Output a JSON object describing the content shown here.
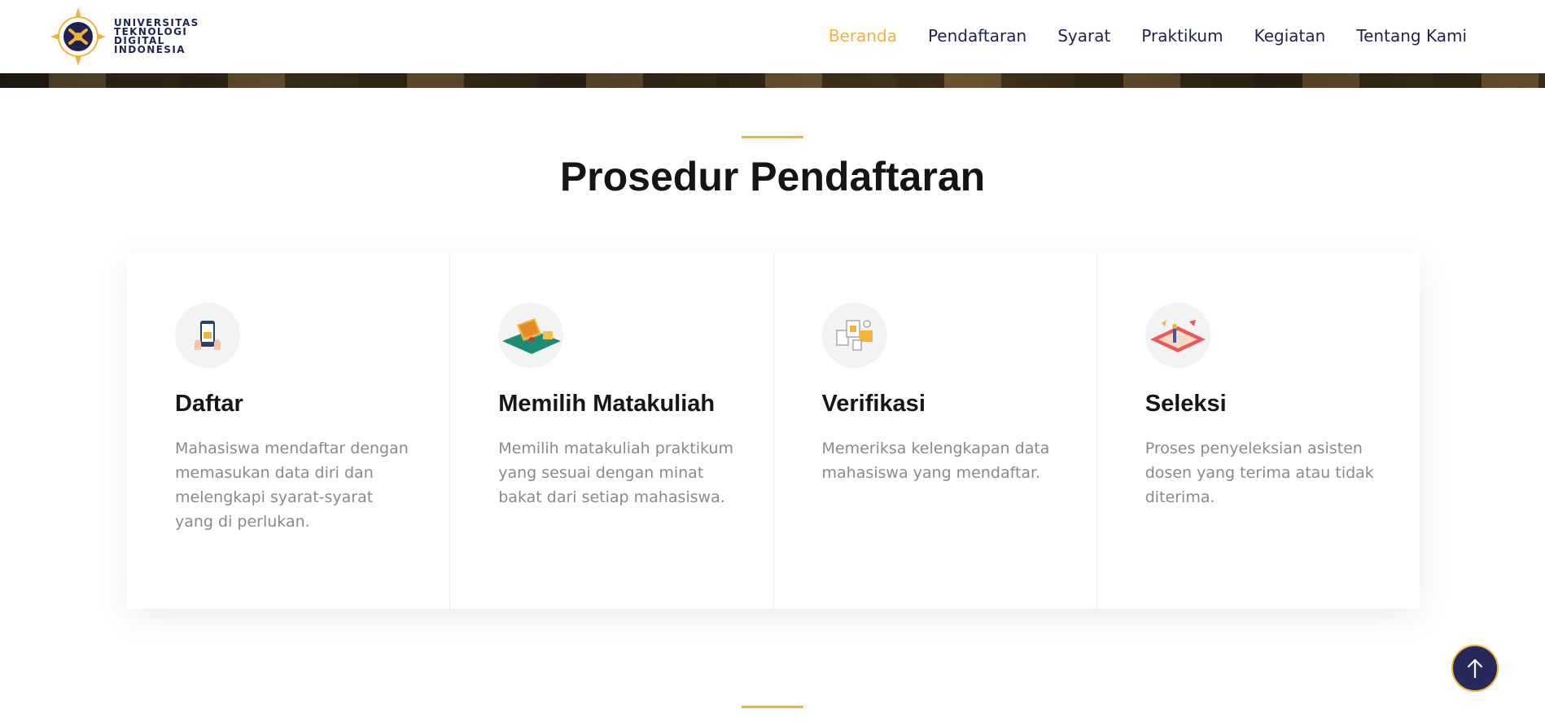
{
  "brand": {
    "lines": [
      "UNIVERSITAS",
      "TEKNOLOGI",
      "DIGITAL",
      "INDONESIA"
    ]
  },
  "nav": {
    "items": [
      {
        "label": "Beranda",
        "active": true
      },
      {
        "label": "Pendaftaran",
        "active": false
      },
      {
        "label": "Syarat",
        "active": false
      },
      {
        "label": "Praktikum",
        "active": false
      },
      {
        "label": "Kegiatan",
        "active": false
      },
      {
        "label": "Tentang Kami",
        "active": false
      }
    ]
  },
  "section": {
    "title": "Prosedur Pendaftaran"
  },
  "cards": [
    {
      "icon": "phone-register-icon",
      "title": "Daftar",
      "desc": "Mahasiswa mendaftar dengan memasukan data diri dan melengkapi syarat-syarat yang di perlukan."
    },
    {
      "icon": "laptop-select-icon",
      "title": "Memilih Matakuliah",
      "desc": "Memilih matakuliah praktikum yang sesuai dengan minat bakat dari setiap mahasiswa."
    },
    {
      "icon": "document-verify-icon",
      "title": "Verifikasi",
      "desc": "Memeriksa kelengkapan data mahasiswa yang mendaftar."
    },
    {
      "icon": "selection-board-icon",
      "title": "Seleksi",
      "desc": "Proses penyeleksian asisten dosen yang terima atau tidak diterima."
    }
  ],
  "colors": {
    "accent": "#f2b33d",
    "navy": "#1f2350",
    "muted_text": "#8a8a8a"
  }
}
